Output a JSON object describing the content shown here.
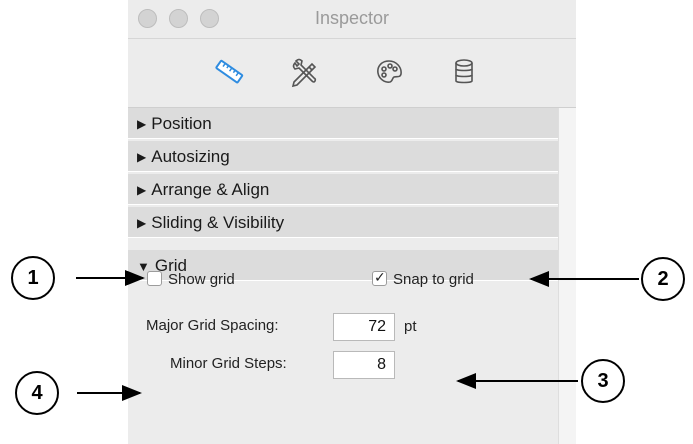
{
  "window": {
    "title": "Inspector"
  },
  "toolbar": {
    "tabs": [
      {
        "icon": "ruler-icon",
        "selected": true
      },
      {
        "icon": "tools-icon",
        "selected": false
      },
      {
        "icon": "palette-icon",
        "selected": false
      },
      {
        "icon": "database-icon",
        "selected": false
      }
    ],
    "accent_color": "#2f8ce0"
  },
  "sections": {
    "position": "Position",
    "autosizing": "Autosizing",
    "arrange": "Arrange & Align",
    "sliding": "Sliding & Visibility",
    "grid": "Grid"
  },
  "grid": {
    "show_grid_label": "Show grid",
    "show_grid_checked": false,
    "snap_label": "Snap to grid",
    "snap_checked": true,
    "major_label": "Major Grid Spacing:",
    "major_value": "72",
    "major_unit": "pt",
    "minor_label": "Minor Grid Steps:",
    "minor_value": "8"
  },
  "callouts": [
    "1",
    "2",
    "3",
    "4"
  ]
}
